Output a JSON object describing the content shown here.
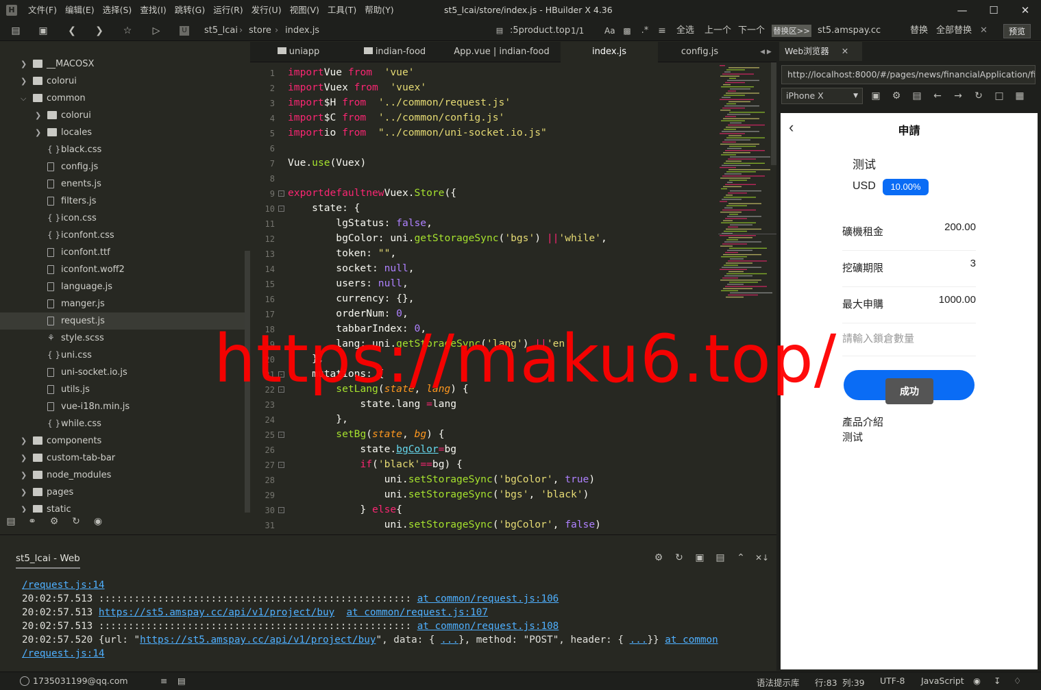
{
  "window": {
    "title": "st5_lcai/store/index.js - HBuilder X 4.36"
  },
  "menu": [
    "文件(F)",
    "编辑(E)",
    "选择(S)",
    "查找(I)",
    "跳转(G)",
    "运行(R)",
    "发行(U)",
    "视图(V)",
    "工具(T)",
    "帮助(Y)"
  ],
  "toolbar": {
    "breadcrumb": [
      "st5_lcai",
      "store",
      "index.js"
    ],
    "search_text": ":5product.top",
    "match_count": "1/1",
    "aa": "Aa",
    "select_all": "全选",
    "prev": "上一个",
    "next": "下一个",
    "replace_area": "替换区>>",
    "replace_text": "st5.amspay.cc",
    "replace": "替换",
    "replace_all": "全部替换",
    "preview": "预览"
  },
  "tree": [
    {
      "label": "__MACOSX",
      "type": "folder",
      "depth": 0,
      "collapsed": true
    },
    {
      "label": "colorui",
      "type": "folder",
      "depth": 0,
      "collapsed": true
    },
    {
      "label": "common",
      "type": "folder",
      "depth": 0,
      "collapsed": false
    },
    {
      "label": "colorui",
      "type": "folder",
      "depth": 1,
      "collapsed": true
    },
    {
      "label": "locales",
      "type": "folder",
      "depth": 1,
      "collapsed": true
    },
    {
      "label": "black.css",
      "type": "css",
      "depth": 1
    },
    {
      "label": "config.js",
      "type": "file",
      "depth": 1
    },
    {
      "label": "enents.js",
      "type": "file",
      "depth": 1
    },
    {
      "label": "filters.js",
      "type": "file",
      "depth": 1
    },
    {
      "label": "icon.css",
      "type": "css",
      "depth": 1
    },
    {
      "label": "iconfont.css",
      "type": "css",
      "depth": 1
    },
    {
      "label": "iconfont.ttf",
      "type": "file",
      "depth": 1
    },
    {
      "label": "iconfont.woff2",
      "type": "file",
      "depth": 1
    },
    {
      "label": "language.js",
      "type": "file",
      "depth": 1
    },
    {
      "label": "manger.js",
      "type": "file",
      "depth": 1
    },
    {
      "label": "request.js",
      "type": "file",
      "depth": 1,
      "selected": true
    },
    {
      "label": "style.scss",
      "type": "scss",
      "depth": 1
    },
    {
      "label": "uni.css",
      "type": "css",
      "depth": 1
    },
    {
      "label": "uni-socket.io.js",
      "type": "file",
      "depth": 1
    },
    {
      "label": "utils.js",
      "type": "file",
      "depth": 1
    },
    {
      "label": "vue-i18n.min.js",
      "type": "file",
      "depth": 1
    },
    {
      "label": "while.css",
      "type": "css",
      "depth": 1
    },
    {
      "label": "components",
      "type": "folder",
      "depth": 0,
      "collapsed": true
    },
    {
      "label": "custom-tab-bar",
      "type": "folder",
      "depth": 0,
      "collapsed": true
    },
    {
      "label": "node_modules",
      "type": "folder",
      "depth": 0,
      "collapsed": true
    },
    {
      "label": "pages",
      "type": "folder",
      "depth": 0,
      "collapsed": true
    },
    {
      "label": "static",
      "type": "folder",
      "depth": 0,
      "collapsed": true
    }
  ],
  "tabs": [
    "uniapp",
    "indian-food",
    "App.vue | indian-food",
    "index.js",
    "config.js"
  ],
  "code_lines": [
    [
      [
        "kw",
        "import"
      ],
      [
        "",
        "Vue "
      ],
      [
        "kw",
        "from"
      ],
      [
        "",
        "  "
      ],
      [
        "st",
        "'vue'"
      ]
    ],
    [
      [
        "kw",
        "import"
      ],
      [
        "",
        "Vuex "
      ],
      [
        "kw",
        "from"
      ],
      [
        "",
        "  "
      ],
      [
        "st",
        "'vuex'"
      ]
    ],
    [
      [
        "kw",
        "import"
      ],
      [
        "",
        "$H "
      ],
      [
        "kw",
        "from"
      ],
      [
        "",
        "  "
      ],
      [
        "st",
        "'../common/request.js'"
      ]
    ],
    [
      [
        "kw",
        "import"
      ],
      [
        "",
        "$C "
      ],
      [
        "kw",
        "from"
      ],
      [
        "",
        "  "
      ],
      [
        "st",
        "'../common/config.js'"
      ]
    ],
    [
      [
        "kw",
        "import"
      ],
      [
        "",
        "io "
      ],
      [
        "kw",
        "from"
      ],
      [
        "",
        "  "
      ],
      [
        "st",
        "\"../common/uni-socket.io.js\""
      ]
    ],
    [],
    [
      [
        "",
        "Vue."
      ],
      [
        "fn",
        "use"
      ],
      [
        "",
        "(Vuex)"
      ]
    ],
    [],
    [
      [
        "kw",
        "export"
      ],
      [
        "",
        ""
      ],
      [
        "kw",
        "default"
      ],
      [
        "",
        ""
      ],
      [
        "kw",
        "new"
      ],
      [
        "",
        "Vuex."
      ],
      [
        "fn",
        "Store"
      ],
      [
        "",
        "({"
      ]
    ],
    [
      [
        "",
        "    state: {"
      ]
    ],
    [
      [
        "",
        "        lgStatus: "
      ],
      [
        "cn",
        "false"
      ],
      [
        "",
        ","
      ]
    ],
    [
      [
        "",
        "        bgColor: uni."
      ],
      [
        "fn",
        "getStorageSync"
      ],
      [
        "",
        "("
      ],
      [
        "st",
        "'bgs'"
      ],
      [
        "",
        ") "
      ],
      [
        "op",
        "||"
      ],
      [
        "",
        ""
      ],
      [
        "st",
        "'while'"
      ],
      [
        "",
        ","
      ]
    ],
    [
      [
        "",
        "        token: "
      ],
      [
        "st",
        "\"\""
      ],
      [
        "",
        ","
      ]
    ],
    [
      [
        "",
        "        socket: "
      ],
      [
        "cn",
        "null"
      ],
      [
        "",
        ","
      ]
    ],
    [
      [
        "",
        "        users: "
      ],
      [
        "cn",
        "null"
      ],
      [
        "",
        ","
      ]
    ],
    [
      [
        "",
        "        currency: {},"
      ]
    ],
    [
      [
        "",
        "        orderNum: "
      ],
      [
        "cn",
        "0"
      ],
      [
        "",
        ","
      ]
    ],
    [
      [
        "",
        "        tabbarIndex: "
      ],
      [
        "cn",
        "0"
      ],
      [
        "",
        ","
      ]
    ],
    [
      [
        "",
        "        lang: uni."
      ],
      [
        "fn",
        "getStorageSync"
      ],
      [
        "",
        "("
      ],
      [
        "st",
        "'lang'"
      ],
      [
        "",
        ") "
      ],
      [
        "op",
        "||"
      ],
      [
        "",
        ""
      ],
      [
        "st",
        "'en'"
      ]
    ],
    [
      [
        "",
        "    },"
      ]
    ],
    [
      [
        "",
        "    mutations: {"
      ]
    ],
    [
      [
        "",
        "        "
      ],
      [
        "fn",
        "setLang"
      ],
      [
        "",
        "("
      ],
      [
        "pa",
        "state"
      ],
      [
        "",
        ", "
      ],
      [
        "pa",
        "lang"
      ],
      [
        "",
        ") {"
      ]
    ],
    [
      [
        "",
        "            state.lang "
      ],
      [
        "op",
        "="
      ],
      [
        "",
        "lang"
      ]
    ],
    [
      [
        "",
        "        },"
      ]
    ],
    [
      [
        "",
        "        "
      ],
      [
        "fn",
        "setBg"
      ],
      [
        "",
        "("
      ],
      [
        "pa",
        "state"
      ],
      [
        "",
        ", "
      ],
      [
        "pa",
        "bg"
      ],
      [
        "",
        ") {"
      ]
    ],
    [
      [
        "",
        "            state."
      ],
      [
        "ul",
        "bgColor"
      ],
      [
        "",
        ""
      ],
      [
        "op",
        "="
      ],
      [
        "",
        "bg"
      ]
    ],
    [
      [
        "",
        "            "
      ],
      [
        "kw",
        "if"
      ],
      [
        "",
        "("
      ],
      [
        "st",
        "'black'"
      ],
      [
        "",
        ""
      ],
      [
        "op",
        "=="
      ],
      [
        "",
        "bg) {"
      ]
    ],
    [
      [
        "",
        "                uni."
      ],
      [
        "fn",
        "setStorageSync"
      ],
      [
        "",
        "("
      ],
      [
        "st",
        "'bgColor'"
      ],
      [
        "",
        ", "
      ],
      [
        "cn",
        "true"
      ],
      [
        "",
        ")"
      ]
    ],
    [
      [
        "",
        "                uni."
      ],
      [
        "fn",
        "setStorageSync"
      ],
      [
        "",
        "("
      ],
      [
        "st",
        "'bgs'"
      ],
      [
        "",
        ", "
      ],
      [
        "st",
        "'black'"
      ],
      [
        "",
        ")"
      ]
    ],
    [
      [
        "",
        "            } "
      ],
      [
        "kw",
        "else"
      ],
      [
        "",
        "{"
      ]
    ],
    [
      [
        "",
        "                uni."
      ],
      [
        "fn",
        "setStorageSync"
      ],
      [
        "",
        "("
      ],
      [
        "st",
        "'bgColor'"
      ],
      [
        "",
        ", "
      ],
      [
        "cn",
        "false"
      ],
      [
        "",
        ")"
      ]
    ]
  ],
  "browser": {
    "tab_title": "Web浏览器",
    "url": "http://localhost:8000/#/pages/news/financialApplication/finan",
    "device": "iPhone X",
    "page": {
      "title": "申請",
      "product_name": "测试",
      "currency": "USD",
      "rate": "10.00%",
      "rows": [
        {
          "label": "礦機租金",
          "value": "200.00"
        },
        {
          "label": "挖礦期限",
          "value": "3"
        },
        {
          "label": "最大申購",
          "value": "1000.00"
        }
      ],
      "input_placeholder": "請輸入鎖倉數量",
      "submit_button": "成功",
      "toast": "成功",
      "intro_title": "產品介紹",
      "intro_text": "测试"
    }
  },
  "console": {
    "title": "st5_lcai - Web",
    "lines": [
      [
        [
          "lnk",
          "/request.js:14"
        ]
      ],
      [
        [
          "",
          "20:02:57.513 ::::::::::::::::::::::::::::::::::::::::::::::::::::: "
        ],
        [
          "lnk",
          "at common/request.js:106"
        ]
      ],
      [
        [
          "",
          "20:02:57.513 "
        ],
        [
          "lnk",
          "https://st5.amspay.cc/api/v1/project/buy"
        ],
        [
          "",
          "  "
        ],
        [
          "lnk",
          "at common/request.js:107"
        ]
      ],
      [
        [
          "",
          "20:02:57.513 ::::::::::::::::::::::::::::::::::::::::::::::::::::: "
        ],
        [
          "lnk",
          "at common/request.js:108"
        ]
      ],
      [
        [
          "",
          "20:02:57.520 {url: \""
        ],
        [
          "lnk",
          "https://st5.amspay.cc/api/v1/project/buy"
        ],
        [
          "",
          "\", data: { "
        ],
        [
          "lnk",
          "..."
        ],
        [
          "",
          "}, method: \"POST\", header: { "
        ],
        [
          "lnk",
          "..."
        ],
        [
          "",
          "}} "
        ],
        [
          "lnk",
          "at common"
        ]
      ],
      [
        [
          "lnk",
          "/request.js:14"
        ]
      ]
    ]
  },
  "status": {
    "user": "1735031199@qq.com",
    "syntax_hint": "语法提示库",
    "line": "行:83",
    "col": "列:39",
    "encoding": "UTF-8",
    "language": "JavaScript"
  },
  "watermark": "https://maku6.top/",
  "colors": {
    "accent_blue": "#0a6cf5",
    "editor_bg": "#272822"
  }
}
